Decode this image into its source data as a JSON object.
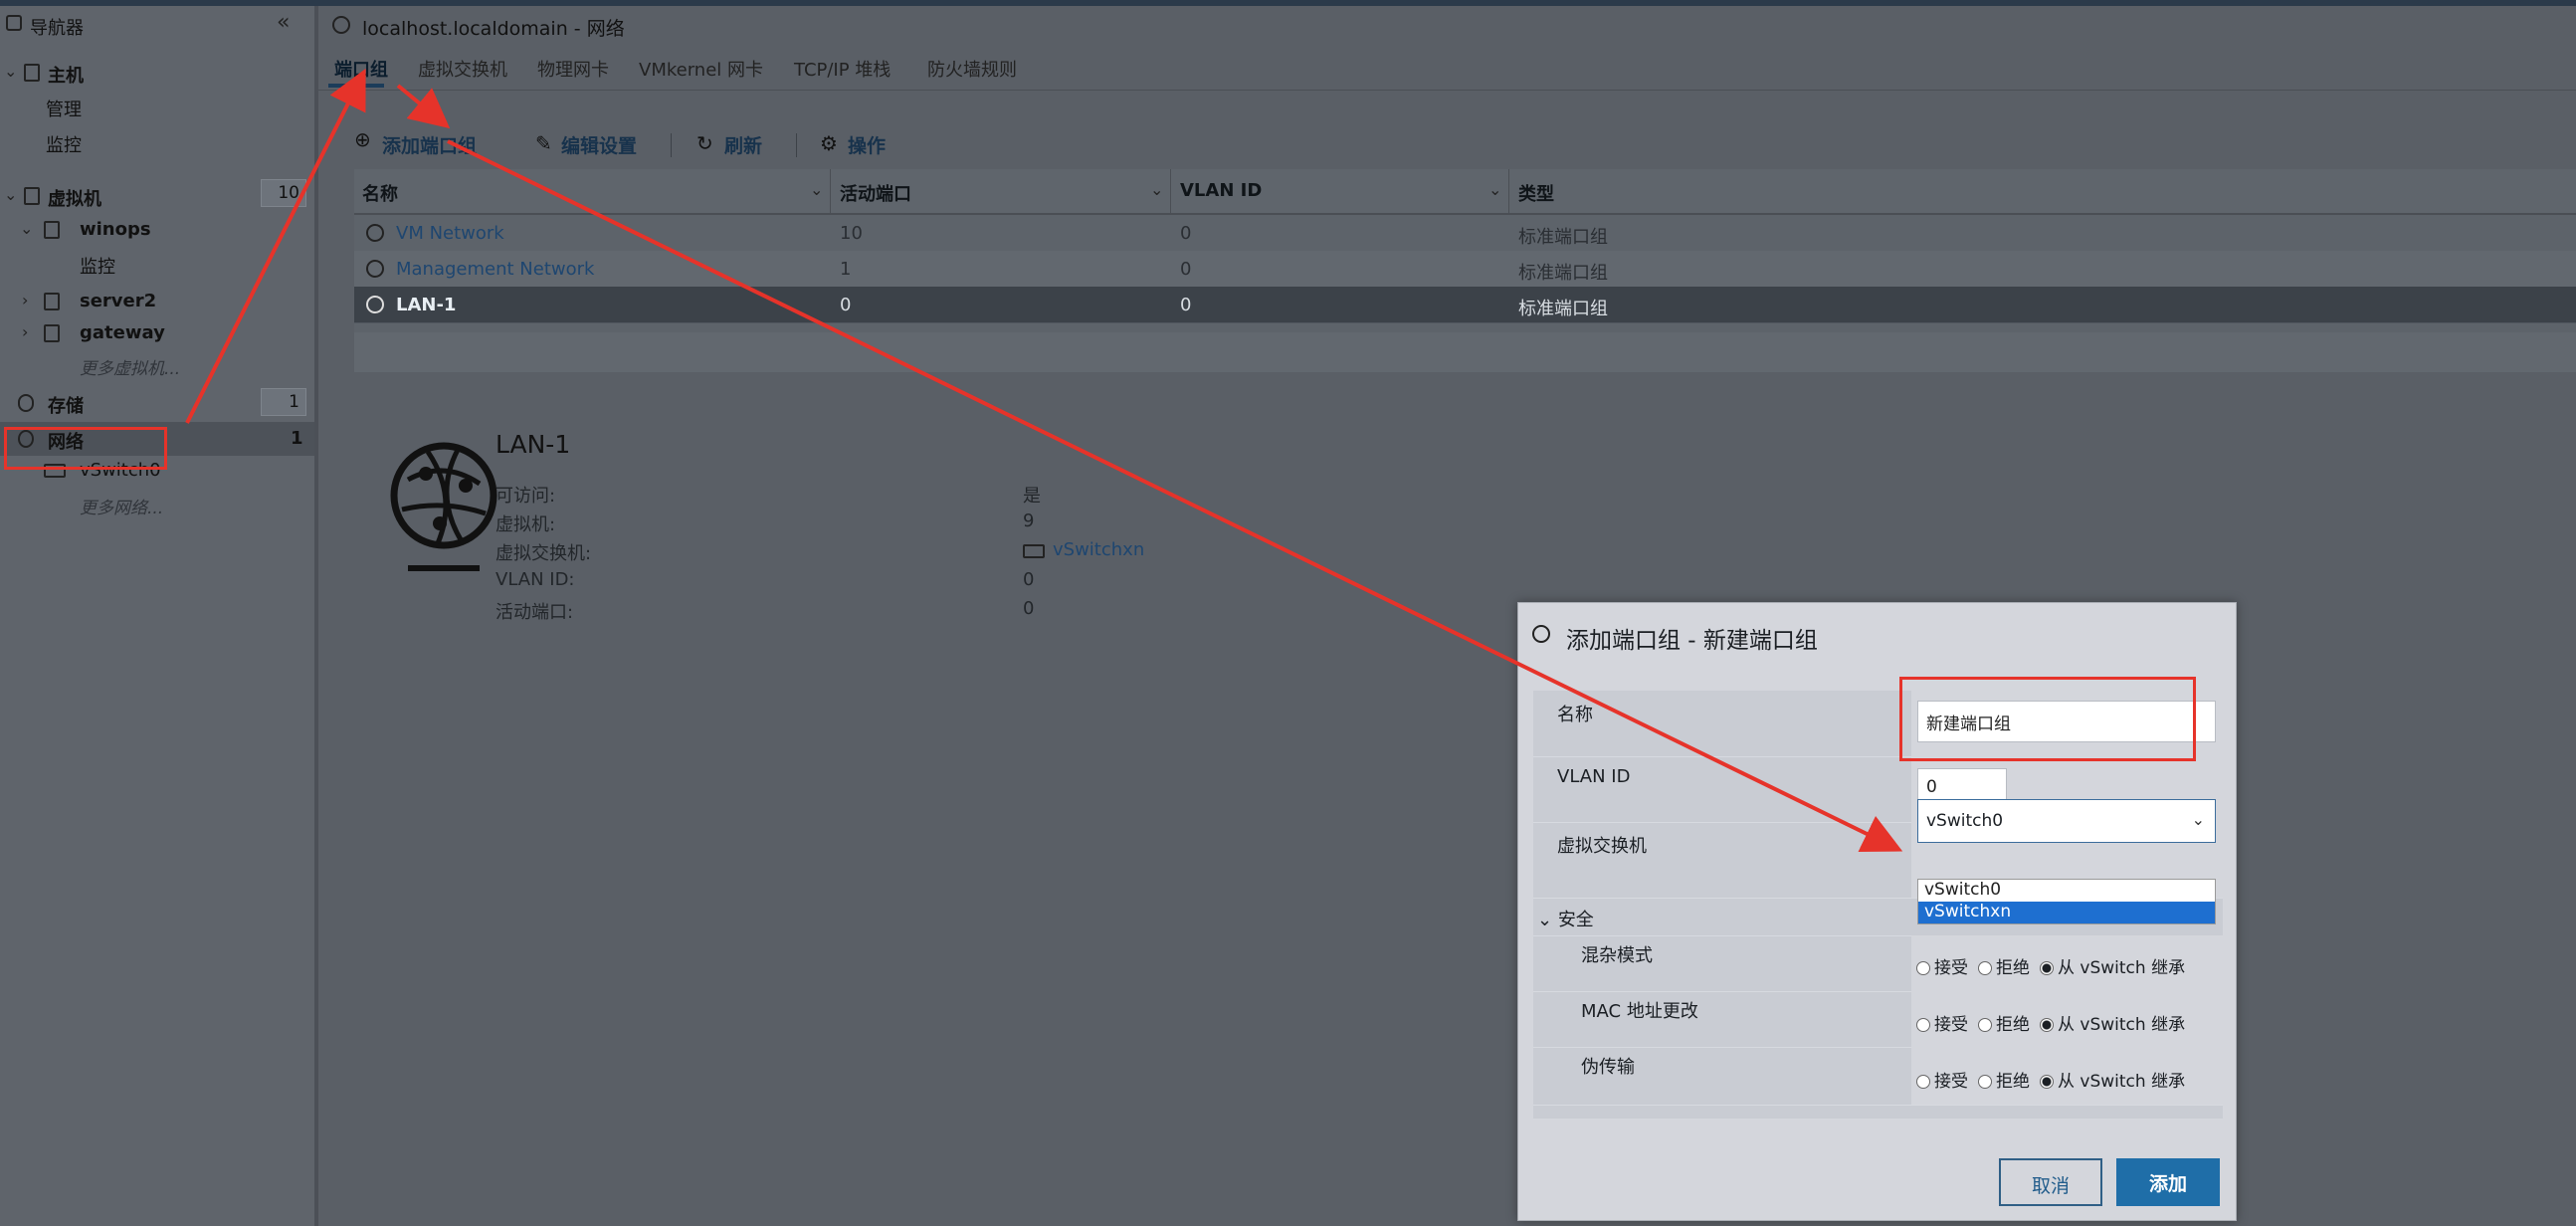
{
  "navigator": {
    "title": "导航器",
    "host": "主机",
    "host_manage": "管理",
    "host_monitor": "监控",
    "vms": "虚拟机",
    "vms_count": "10",
    "vm_winops": "winops",
    "vm_winops_monitor": "监控",
    "vm_server2": "server2",
    "vm_gateway": "gateway",
    "more_vms": "更多虚拟机...",
    "storage": "存储",
    "storage_count": "1",
    "network": "网络",
    "network_count": "1",
    "vswitch0": "vSwitch0",
    "more_networks": "更多网络..."
  },
  "window": {
    "title": "localhost.localdomain - 网络"
  },
  "tabs": [
    "端口组",
    "虚拟交换机",
    "物理网卡",
    "VMkernel 网卡",
    "TCP/IP 堆栈",
    "防火墙规则"
  ],
  "toolbar": {
    "add": "添加端口组",
    "edit": "编辑设置",
    "refresh": "刷新",
    "actions": "操作"
  },
  "table": {
    "columns": [
      "名称",
      "活动端口",
      "VLAN ID",
      "类型"
    ],
    "rows": [
      {
        "name": "VM Network",
        "ports": "10",
        "vlan": "0",
        "type": "标准端口组"
      },
      {
        "name": "Management Network",
        "ports": "1",
        "vlan": "0",
        "type": "标准端口组"
      },
      {
        "name": "LAN-1",
        "ports": "0",
        "vlan": "0",
        "type": "标准端口组"
      }
    ]
  },
  "detail": {
    "title": "LAN-1",
    "labels": [
      "可访问:",
      "虚拟机:",
      "虚拟交换机:",
      "VLAN ID:",
      "活动端口:"
    ],
    "values": [
      "是",
      "9",
      "vSwitchxn",
      "0",
      "0"
    ]
  },
  "dialog": {
    "title": "添加端口组 - 新建端口组",
    "name_label": "名称",
    "name_value": "新建端口组",
    "vlan_label": "VLAN ID",
    "vlan_value": "0",
    "vswitch_label": "虚拟交换机",
    "vswitch_value": "vSwitch0",
    "vswitch_options": [
      "vSwitch0",
      "vSwitchxn"
    ],
    "security_label": "安全",
    "promisc_label": "混杂模式",
    "mac_label": "MAC 地址更改",
    "forged_label": "伪传输",
    "opt_accept": "接受",
    "opt_reject": "拒绝",
    "opt_inherit": "从 vSwitch 继承",
    "cancel": "取消",
    "add": "添加"
  },
  "colors": {
    "annotation": "#e6332a",
    "accent": "#1f6ea8",
    "selected_option": "#1e6fd0"
  }
}
